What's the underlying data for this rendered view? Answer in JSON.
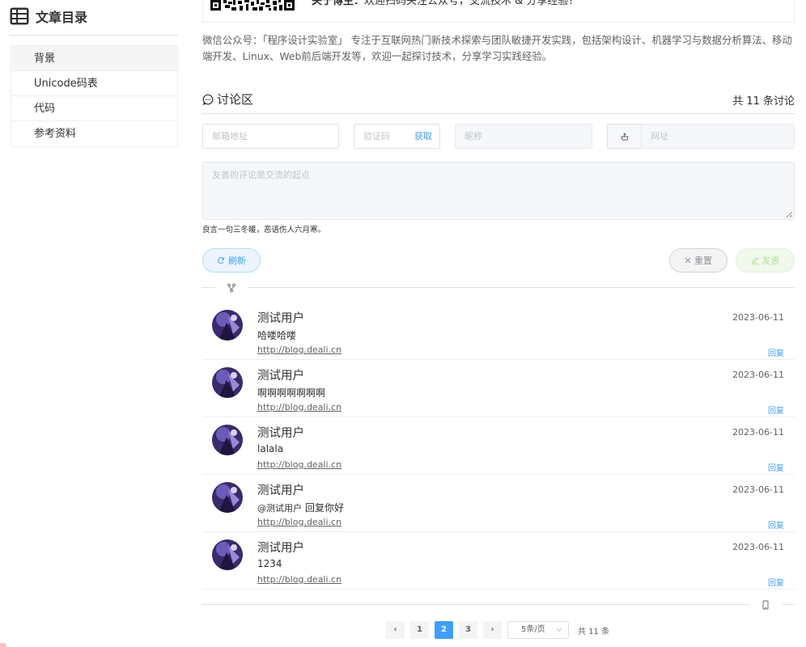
{
  "sidebar": {
    "title": "文章目录",
    "items": [
      {
        "label": "背景",
        "active": true
      },
      {
        "label": "Unicode码表",
        "active": false
      },
      {
        "label": "代码",
        "active": false
      },
      {
        "label": "参考资料",
        "active": false
      }
    ]
  },
  "about": {
    "label": "关于博主：",
    "text": "欢迎扫码关注公众号，交流技术 & 分享经验！"
  },
  "intro": "微信公众号：「程序设计实验室」 专注于互联网热门新技术探索与团队敏捷开发实践，包括架构设计、机器学习与数据分析算法、移动端开发、Linux、Web前后端开发等，欢迎一起探讨技术，分享学习实践经验。",
  "discussion": {
    "title": "讨论区",
    "count": "共 11 条讨论"
  },
  "form": {
    "email_placeholder": "邮箱地址",
    "code_placeholder": "验证码",
    "code_get": "获取",
    "nickname_placeholder": "昵称",
    "url_placeholder": "网址",
    "comment_placeholder": "友善的评论是交流的起点",
    "tip": "良言一句三冬暖，恶语伤人六月寒。",
    "refresh_label": "刷新",
    "reset_label": "重置",
    "post_label": "发表"
  },
  "comments": [
    {
      "name": "测试用户",
      "date": "2023-06-11",
      "text": "哈喽哈喽",
      "at": "",
      "link": "http://blog.deali.cn",
      "reply": "回复"
    },
    {
      "name": "测试用户",
      "date": "2023-06-11",
      "text": "啊啊啊啊啊啊啊",
      "at": "",
      "link": "http://blog.deali.cn",
      "reply": "回复"
    },
    {
      "name": "测试用户",
      "date": "2023-06-11",
      "text": "lalala",
      "at": "",
      "link": "http://blog.deali.cn",
      "reply": "回复"
    },
    {
      "name": "测试用户",
      "date": "2023-06-11",
      "text": "回复你好",
      "at": "@测试用户",
      "link": "http://blog.deali.cn",
      "reply": "回复"
    },
    {
      "name": "测试用户",
      "date": "2023-06-11",
      "text": "1234",
      "at": "",
      "link": "http://blog.deali.cn",
      "reply": "回复"
    }
  ],
  "pagination": {
    "prev": "‹",
    "next": "›",
    "pages": [
      "1",
      "2",
      "3"
    ],
    "current": "2",
    "page_size": "5条/页",
    "total": "共 11 条"
  },
  "colors": {
    "primary": "#409eff",
    "success_light": "#b3e19d",
    "border": "#dcdfe6"
  }
}
